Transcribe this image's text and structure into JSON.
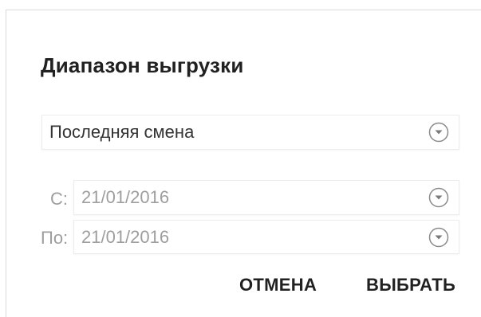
{
  "dialog": {
    "title": "Диапазон выгрузки",
    "period": {
      "value": "Последняя смена",
      "icon": "chevron-down-circle-icon"
    },
    "from": {
      "label": "С:",
      "value": "21/01/2016",
      "icon": "chevron-down-circle-icon"
    },
    "to": {
      "label": "По:",
      "value": "21/01/2016",
      "icon": "chevron-down-circle-icon"
    },
    "actions": {
      "cancel_label": "ОТМЕНА",
      "select_label": "ВЫБРАТЬ"
    }
  },
  "colors": {
    "text_primary": "#212121",
    "text_disabled": "#9e9e9e",
    "field_border": "#ececec"
  }
}
